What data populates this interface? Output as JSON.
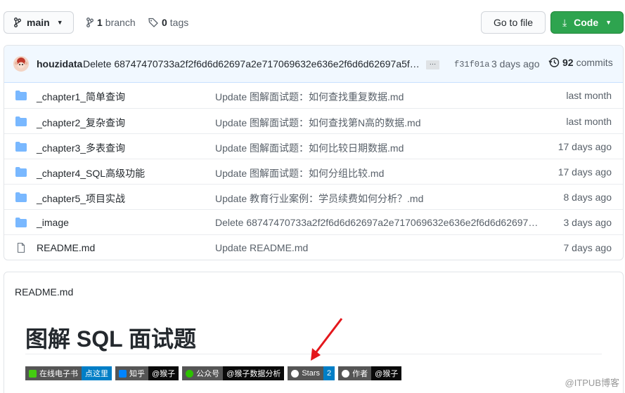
{
  "toolbar": {
    "branch_label": "main",
    "branch_count": "1",
    "branch_word": "branch",
    "tag_count": "0",
    "tag_word": "tags",
    "go_to_file": "Go to file",
    "code_label": "Code"
  },
  "commit": {
    "author": "houzidata",
    "message": "Delete 68747470733a2f2f6d6d62697a2e717069632e636e2f6d6d62697a5f706...",
    "ellipsis": "…",
    "sha": "f31f01a",
    "time": "3 days ago",
    "count": "92",
    "count_word": "commits"
  },
  "files": [
    {
      "name": "_chapter1_简单查询",
      "message": "Update 图解面试题：如何查找重复数据.md",
      "time": "last month",
      "type": "folder"
    },
    {
      "name": "_chapter2_复杂查询",
      "message": "Update 图解面试题：如何查找第N高的数据.md",
      "time": "last month",
      "type": "folder"
    },
    {
      "name": "_chapter3_多表查询",
      "message": "Update 图解面试题：如何比较日期数据.md",
      "time": "17 days ago",
      "type": "folder"
    },
    {
      "name": "_chapter4_SQL高级功能",
      "message": "Update 图解面试题：如何分组比较.md",
      "time": "17 days ago",
      "type": "folder"
    },
    {
      "name": "_chapter5_项目实战",
      "message": "Update 教育行业案例：学员续费如何分析？.md",
      "time": "8 days ago",
      "type": "folder"
    },
    {
      "name": "_image",
      "message": "Delete 68747470733a2f2f6d6d62697a2e717069632e636e2f6d6d62697a5...",
      "time": "3 days ago",
      "type": "folder"
    },
    {
      "name": "README.md",
      "message": "Update README.md",
      "time": "7 days ago",
      "type": "file"
    }
  ],
  "readme": {
    "header": "README.md",
    "title": "图解 SQL 面试题",
    "badges": [
      {
        "left": "在线电子书",
        "right": "点这里"
      },
      {
        "left": "知乎",
        "right": "@猴子"
      },
      {
        "left": "公众号",
        "right": "@猴子数据分析"
      },
      {
        "left": "Stars",
        "right": "2"
      },
      {
        "left": "作者",
        "right": "@猴子"
      }
    ]
  },
  "watermark": "@ITPUB博客",
  "colors": {
    "folder": "#79b8ff",
    "code_button": "#2ea44f",
    "annotation_arrow": "#e4171c"
  }
}
